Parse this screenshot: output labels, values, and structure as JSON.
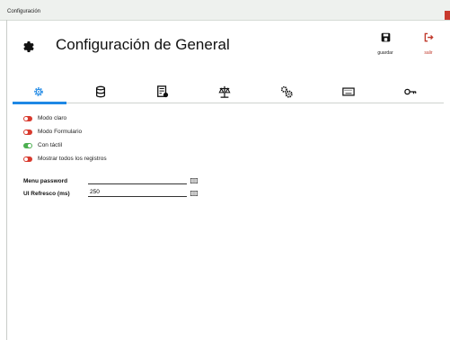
{
  "window": {
    "title": "Configuración"
  },
  "header": {
    "title": "Configuración de General",
    "save_label": "guardar",
    "exit_label": "salir"
  },
  "tabs": [
    {
      "icon": "gear-icon",
      "active": true
    },
    {
      "icon": "database-icon",
      "active": false
    },
    {
      "icon": "document-settings-icon",
      "active": false
    },
    {
      "icon": "balance-scale-icon",
      "active": false
    },
    {
      "icon": "cogs-icon",
      "active": false
    },
    {
      "icon": "keyboard-icon",
      "active": false
    },
    {
      "icon": "key-icon",
      "active": false
    }
  ],
  "toggles": [
    {
      "label": "Modo claro",
      "state": "off"
    },
    {
      "label": "Modo Formulario",
      "state": "off"
    },
    {
      "label": "Con táctil",
      "state": "on"
    },
    {
      "label": "Mostrar todos los registros",
      "state": "off"
    }
  ],
  "fields": {
    "menu_password": {
      "label": "Menu password",
      "value": ""
    },
    "ui_refresh": {
      "label": "UI Refresco (ms)",
      "value": "250"
    }
  },
  "colors": {
    "accent": "#1e88e5",
    "toggle_off": "#d83a2e",
    "toggle_on": "#4caf50",
    "exit": "#c0392b"
  }
}
